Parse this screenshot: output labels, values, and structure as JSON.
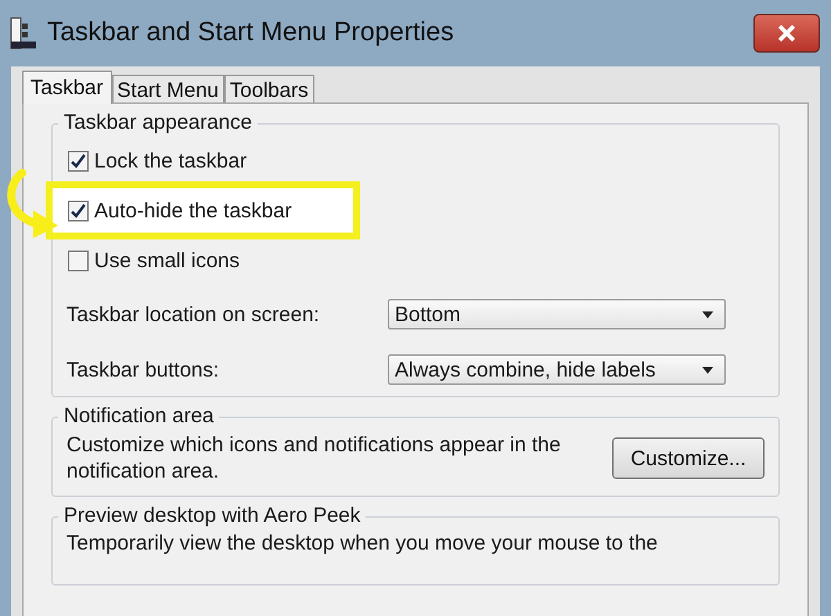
{
  "window": {
    "title": "Taskbar and Start Menu Properties"
  },
  "tabs": [
    {
      "label": "Taskbar",
      "selected": true
    },
    {
      "label": "Start Menu",
      "selected": false
    },
    {
      "label": "Toolbars",
      "selected": false
    }
  ],
  "appearance": {
    "title": "Taskbar appearance",
    "checkboxes": [
      {
        "label": "Lock the taskbar",
        "checked": true,
        "highlighted": false
      },
      {
        "label": "Auto-hide the taskbar",
        "checked": true,
        "highlighted": true
      },
      {
        "label": "Use small icons",
        "checked": false,
        "highlighted": false
      }
    ],
    "dropdowns": [
      {
        "label": "Taskbar location on screen:",
        "value": "Bottom"
      },
      {
        "label": "Taskbar buttons:",
        "value": "Always combine, hide labels"
      }
    ]
  },
  "notification": {
    "title": "Notification area",
    "text": "Customize which icons and notifications appear in the notification area.",
    "button": "Customize..."
  },
  "peek": {
    "title": "Preview desktop with Aero Peek",
    "text": "Temporarily view the desktop when you move your mouse to the"
  }
}
